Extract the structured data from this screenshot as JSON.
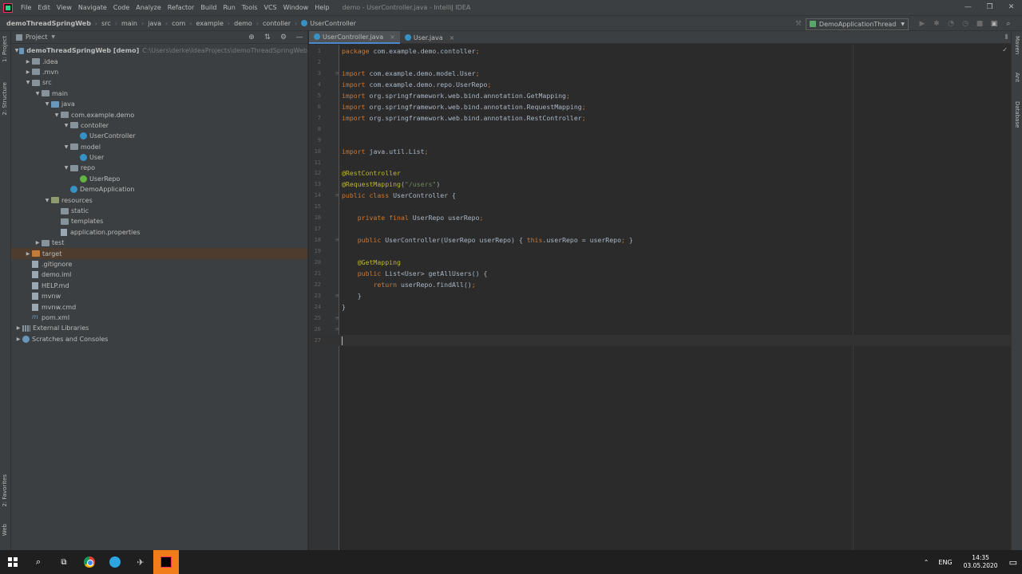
{
  "window": {
    "title": "demo - UserController.java - IntelliJ IDEA",
    "menu": [
      "File",
      "Edit",
      "View",
      "Navigate",
      "Code",
      "Analyze",
      "Refactor",
      "Build",
      "Run",
      "Tools",
      "VCS",
      "Window",
      "Help"
    ],
    "controls": [
      "—",
      "❐",
      "✕"
    ]
  },
  "breadcrumbs": [
    "demoThreadSpringWeb",
    "src",
    "main",
    "java",
    "com",
    "example",
    "demo",
    "contoller",
    "UserController"
  ],
  "run_config": "DemoApplicationThread",
  "left_tabs": [
    "1: Project",
    "2: Structure",
    "2: Favorites",
    "Web"
  ],
  "right_tabs": [
    "Maven",
    "Ant",
    "Database"
  ],
  "project_panel": {
    "title": "Project",
    "tree": [
      {
        "label": "demoThreadSpringWeb [demo]",
        "path": "C:\\Users\\derke\\IdeaProjects\\demoThreadSpringWeb",
        "indent": 0,
        "arrow": "▼",
        "icon": "folder-blue",
        "bold": true
      },
      {
        "label": ".idea",
        "indent": 1,
        "arrow": "▶",
        "icon": "folder"
      },
      {
        "label": ".mvn",
        "indent": 1,
        "arrow": "▶",
        "icon": "folder"
      },
      {
        "label": "src",
        "indent": 1,
        "arrow": "▼",
        "icon": "folder"
      },
      {
        "label": "main",
        "indent": 2,
        "arrow": "▼",
        "icon": "folder"
      },
      {
        "label": "java",
        "indent": 3,
        "arrow": "▼",
        "icon": "folder-blue"
      },
      {
        "label": "com.example.demo",
        "indent": 4,
        "arrow": "▼",
        "icon": "folder"
      },
      {
        "label": "contoller",
        "indent": 5,
        "arrow": "▼",
        "icon": "folder"
      },
      {
        "label": "UserController",
        "indent": 6,
        "arrow": "",
        "icon": "class"
      },
      {
        "label": "model",
        "indent": 5,
        "arrow": "▼",
        "icon": "folder"
      },
      {
        "label": "User",
        "indent": 6,
        "arrow": "",
        "icon": "class"
      },
      {
        "label": "repo",
        "indent": 5,
        "arrow": "▼",
        "icon": "folder"
      },
      {
        "label": "UserRepo",
        "indent": 6,
        "arrow": "",
        "icon": "interface"
      },
      {
        "label": "DemoApplication",
        "indent": 5,
        "arrow": "",
        "icon": "class"
      },
      {
        "label": "resources",
        "indent": 3,
        "arrow": "▼",
        "icon": "folder-res"
      },
      {
        "label": "static",
        "indent": 4,
        "arrow": "",
        "icon": "folder"
      },
      {
        "label": "templates",
        "indent": 4,
        "arrow": "",
        "icon": "folder"
      },
      {
        "label": "application.properties",
        "indent": 4,
        "arrow": "",
        "icon": "file"
      },
      {
        "label": "test",
        "indent": 2,
        "arrow": "▶",
        "icon": "folder"
      },
      {
        "label": "target",
        "indent": 1,
        "arrow": "▶",
        "icon": "folder-orange",
        "selected": true
      },
      {
        "label": ".gitignore",
        "indent": 1,
        "arrow": "",
        "icon": "file"
      },
      {
        "label": "demo.iml",
        "indent": 1,
        "arrow": "",
        "icon": "file"
      },
      {
        "label": "HELP.md",
        "indent": 1,
        "arrow": "",
        "icon": "file"
      },
      {
        "label": "mvnw",
        "indent": 1,
        "arrow": "",
        "icon": "file"
      },
      {
        "label": "mvnw.cmd",
        "indent": 1,
        "arrow": "",
        "icon": "file"
      },
      {
        "label": "pom.xml",
        "indent": 1,
        "arrow": "",
        "icon": "maven"
      },
      {
        "label": "External Libraries",
        "indent": 0,
        "arrow": "▶",
        "icon": "library"
      },
      {
        "label": "Scratches and Consoles",
        "indent": 0,
        "arrow": "▶",
        "icon": "scratch"
      }
    ]
  },
  "editor_tabs": [
    {
      "label": "UserController.java",
      "active": true
    },
    {
      "label": "User.java",
      "active": false
    }
  ],
  "code": [
    [
      [
        "kw",
        "package "
      ],
      [
        "t",
        "com.example.demo.contoller"
      ],
      [
        "kw",
        ";"
      ]
    ],
    [],
    [
      [
        "kw",
        "import "
      ],
      [
        "t",
        "com.example.demo.model.User"
      ],
      [
        "kw",
        ";"
      ]
    ],
    [
      [
        "kw",
        "import "
      ],
      [
        "t",
        "com.example.demo.repo.UserRepo"
      ],
      [
        "kw",
        ";"
      ]
    ],
    [
      [
        "kw",
        "import "
      ],
      [
        "t",
        "org.springframework.web.bind.annotation.GetMapping"
      ],
      [
        "kw",
        ";"
      ]
    ],
    [
      [
        "kw",
        "import "
      ],
      [
        "t",
        "org.springframework.web.bind.annotation.RequestMapping"
      ],
      [
        "kw",
        ";"
      ]
    ],
    [
      [
        "kw",
        "import "
      ],
      [
        "t",
        "org.springframework.web.bind.annotation.RestController"
      ],
      [
        "kw",
        ";"
      ]
    ],
    [],
    [],
    [
      [
        "kw",
        "import "
      ],
      [
        "t",
        "java.util.List"
      ],
      [
        "kw",
        ";"
      ]
    ],
    [],
    [
      [
        "ann",
        "@RestController"
      ]
    ],
    [
      [
        "ann",
        "@RequestMapping"
      ],
      [
        "t",
        "("
      ],
      [
        "str",
        "\"/users\""
      ],
      [
        "t",
        ")"
      ]
    ],
    [
      [
        "kw",
        "public class "
      ],
      [
        "t",
        "UserController {"
      ]
    ],
    [],
    [
      [
        "t",
        "    "
      ],
      [
        "kw",
        "private final "
      ],
      [
        "t",
        "UserRepo userRepo"
      ],
      [
        "kw",
        ";"
      ]
    ],
    [],
    [
      [
        "t",
        "    "
      ],
      [
        "kw",
        "public "
      ],
      [
        "t",
        "UserController(UserRepo userRepo) { "
      ],
      [
        "kw",
        "this"
      ],
      [
        "t",
        ".userRepo = userRepo"
      ],
      [
        "kw",
        ";"
      ],
      [
        "t",
        " }"
      ]
    ],
    [],
    [
      [
        "t",
        "    "
      ],
      [
        "ann",
        "@GetMapping"
      ]
    ],
    [
      [
        "t",
        "    "
      ],
      [
        "kw",
        "public "
      ],
      [
        "t",
        "List<User> getAllUsers() {"
      ]
    ],
    [
      [
        "t",
        "        "
      ],
      [
        "kw",
        "return "
      ],
      [
        "t",
        "userRepo.findAll()"
      ],
      [
        "kw",
        ";"
      ]
    ],
    [
      [
        "t",
        "    }"
      ]
    ],
    [
      [
        "t",
        "}"
      ]
    ],
    [],
    [],
    [
      [
        "caret",
        ""
      ]
    ]
  ],
  "taskbar": {
    "tray_lang": "ENG",
    "time": "14:35",
    "date": "03.05.2020"
  },
  "colors": {
    "keyword": "#cc7832",
    "string": "#6a8759",
    "annotation": "#bbb529",
    "text": "#a9b7c6"
  }
}
